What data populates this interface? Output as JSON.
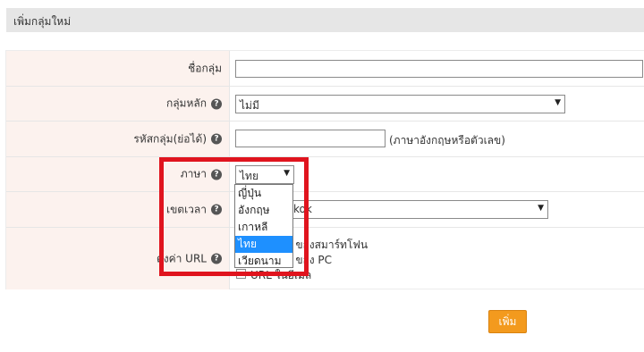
{
  "header": {
    "title": "เพิ่มกลุ่มใหม่"
  },
  "form": {
    "group_name": {
      "label": "ชื่อกลุ่ม",
      "value": ""
    },
    "parent_group": {
      "label": "กลุ่มหลัก",
      "help_icon": "?",
      "selected": "ไม่มี"
    },
    "group_code": {
      "label": "รหัสกลุ่ม(ย่อได้)",
      "help_icon": "?",
      "value": "",
      "hint": "(ภาษาอังกฤษหรือตัวเลข)"
    },
    "language": {
      "label": "ภาษา",
      "help_icon": "?",
      "selected": "ไทย",
      "options": [
        "ญี่ปุ่น",
        "อังกฤษ",
        "เกาหลี",
        "ไทย",
        "เวียดนาม"
      ],
      "highlighted_option": "ไทย"
    },
    "timezone": {
      "label": "เขตเวลา",
      "help_icon": "?",
      "selected": "Asia/Bangkok"
    },
    "url_settings": {
      "label": "ตั้งค่า URL",
      "help_icon": "?",
      "options": [
        {
          "label": "MyPage ของสมาร์ทโฟน"
        },
        {
          "label": "MyPage ของ PC"
        },
        {
          "label": "URL ในอีเมล"
        }
      ]
    }
  },
  "actions": {
    "submit_label": "เพิ่ม"
  },
  "colors": {
    "label_bg": "#fcf2ee",
    "header_bg": "#e6e6e6",
    "highlight_border": "#e0141e",
    "dropdown_selected": "#1e90ff",
    "submit_bg": "#f39a1e"
  }
}
